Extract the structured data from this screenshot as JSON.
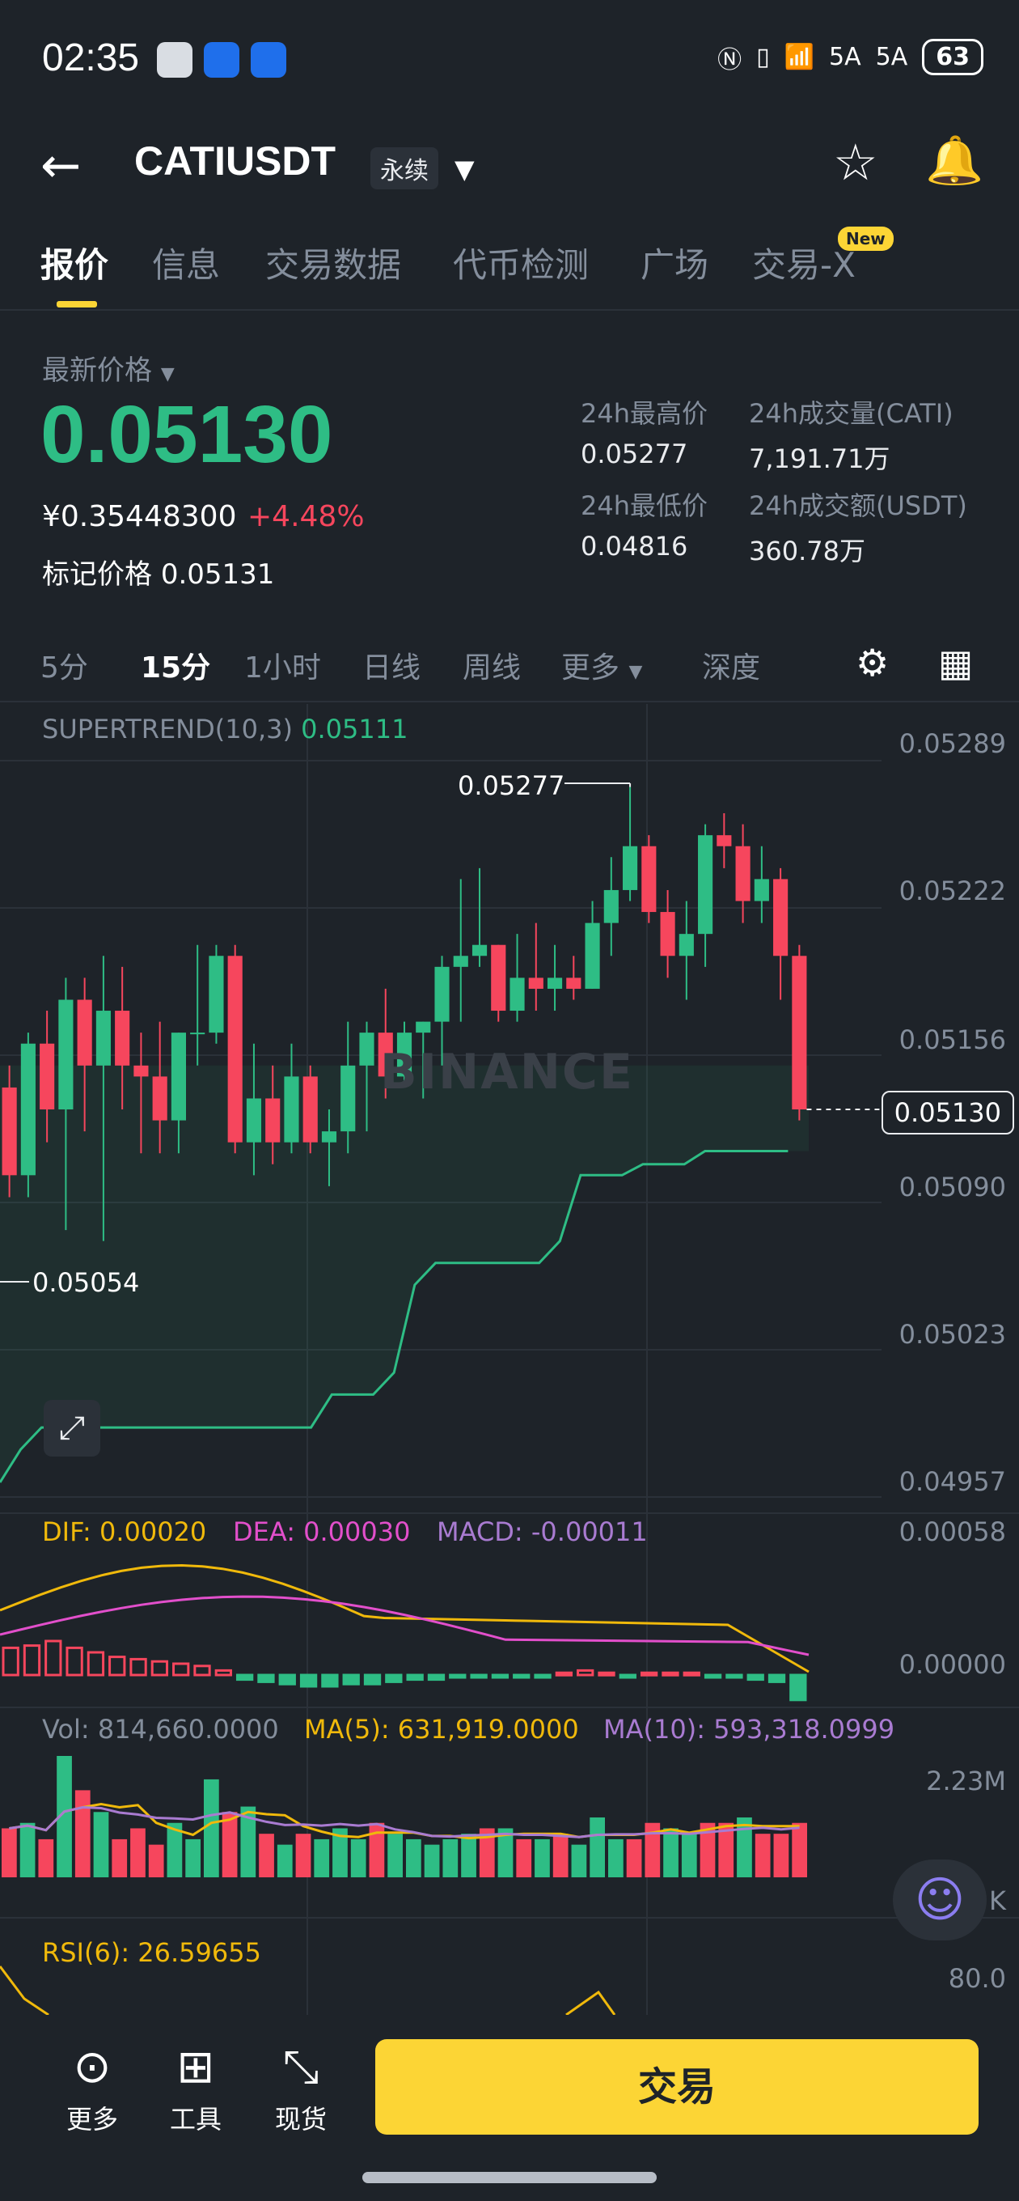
{
  "status_bar": {
    "time": "02:35",
    "network_icons": [
      "N",
      "vibrate",
      "wifi",
      "5A",
      "5A"
    ],
    "battery": "63"
  },
  "header": {
    "symbol": "CATIUSDT",
    "contract_type": "永续",
    "icons": [
      "back-arrow-icon",
      "caret-down-icon",
      "star-icon",
      "bell-icon"
    ]
  },
  "tabs": [
    {
      "label": "报价",
      "active": true
    },
    {
      "label": "信息"
    },
    {
      "label": "交易数据"
    },
    {
      "label": "代币检测"
    },
    {
      "label": "广场"
    },
    {
      "label": "交易-X",
      "badge": "New"
    }
  ],
  "price": {
    "label": "最新价格",
    "last": "0.05130",
    "cny": "¥0.35448300",
    "change": "+4.48%",
    "mark_label": "标记价格",
    "mark": "0.05131"
  },
  "stats": {
    "high_label": "24h最高价",
    "high": "0.05277",
    "vol_label": "24h成交量(CATI)",
    "vol": "7,191.71万",
    "low_label": "24h最低价",
    "low": "0.04816",
    "turnover_label": "24h成交额(USDT)",
    "turnover": "360.78万"
  },
  "intervals": [
    {
      "label": "5分"
    },
    {
      "label": "15分",
      "active": true
    },
    {
      "label": "1小时"
    },
    {
      "label": "日线"
    },
    {
      "label": "周线"
    },
    {
      "label": "更多"
    },
    {
      "label": "深度"
    }
  ],
  "chart": {
    "supertrend_label": "SUPERTREND(10,3)",
    "supertrend_value": "0.05111",
    "price_axis": [
      "0.05289",
      "0.05222",
      "0.05156",
      "0.05090",
      "0.05023",
      "0.04957"
    ],
    "current_price": "0.05130",
    "high_marker": "0.05277",
    "low_marker": "0.05054",
    "watermark": "BINANCE",
    "macd": {
      "dif": "DIF: 0.00020",
      "dea": "DEA: 0.00030",
      "macd": "MACD: -0.00011",
      "axis_top": "0.00058",
      "axis_zero": "0.00000"
    },
    "vol": {
      "vol": "Vol: 814,660.0000",
      "ma5": "MA(5): 631,919.0000",
      "ma10": "MA(10): 593,318.0999",
      "axis_top": "2.23M",
      "axis_k": "K"
    },
    "rsi": {
      "label": "RSI(6): 26.59655",
      "axis_top": "80.0"
    },
    "colors": {
      "up": "#2ebd85",
      "down": "#f6465d",
      "dif": "#f0b90b",
      "dea": "#e24fcb",
      "macd": "#a97bd1"
    }
  },
  "chart_data": {
    "type": "candlestick",
    "interval": "15分",
    "ylim": [
      0.04957,
      0.05289
    ],
    "candles": [
      {
        "o": 0.0514,
        "h": 0.0515,
        "l": 0.0509,
        "c": 0.051
      },
      {
        "o": 0.051,
        "h": 0.05165,
        "l": 0.0509,
        "c": 0.0516
      },
      {
        "o": 0.0516,
        "h": 0.05175,
        "l": 0.05115,
        "c": 0.0513
      },
      {
        "o": 0.0513,
        "h": 0.0519,
        "l": 0.05075,
        "c": 0.0518
      },
      {
        "o": 0.0518,
        "h": 0.0519,
        "l": 0.0512,
        "c": 0.0515
      },
      {
        "o": 0.0515,
        "h": 0.052,
        "l": 0.0507,
        "c": 0.05175
      },
      {
        "o": 0.05175,
        "h": 0.05195,
        "l": 0.0513,
        "c": 0.0515
      },
      {
        "o": 0.0515,
        "h": 0.05165,
        "l": 0.0511,
        "c": 0.05145
      },
      {
        "o": 0.05145,
        "h": 0.0517,
        "l": 0.0511,
        "c": 0.05125
      },
      {
        "o": 0.05125,
        "h": 0.05165,
        "l": 0.0511,
        "c": 0.05165
      },
      {
        "o": 0.05165,
        "h": 0.05205,
        "l": 0.0515,
        "c": 0.05165
      },
      {
        "o": 0.05165,
        "h": 0.05205,
        "l": 0.0516,
        "c": 0.052
      },
      {
        "o": 0.052,
        "h": 0.05205,
        "l": 0.0511,
        "c": 0.05115
      },
      {
        "o": 0.05115,
        "h": 0.0516,
        "l": 0.051,
        "c": 0.05135
      },
      {
        "o": 0.05135,
        "h": 0.0515,
        "l": 0.05105,
        "c": 0.05115
      },
      {
        "o": 0.05115,
        "h": 0.0516,
        "l": 0.0511,
        "c": 0.05145
      },
      {
        "o": 0.05145,
        "h": 0.0515,
        "l": 0.0511,
        "c": 0.05115
      },
      {
        "o": 0.05115,
        "h": 0.0513,
        "l": 0.05095,
        "c": 0.0512
      },
      {
        "o": 0.0512,
        "h": 0.0517,
        "l": 0.0511,
        "c": 0.0515
      },
      {
        "o": 0.0515,
        "h": 0.0517,
        "l": 0.0512,
        "c": 0.05165
      },
      {
        "o": 0.05165,
        "h": 0.05185,
        "l": 0.05135,
        "c": 0.05145
      },
      {
        "o": 0.05145,
        "h": 0.0517,
        "l": 0.0514,
        "c": 0.05165
      },
      {
        "o": 0.05165,
        "h": 0.0517,
        "l": 0.05135,
        "c": 0.0517
      },
      {
        "o": 0.0517,
        "h": 0.052,
        "l": 0.0515,
        "c": 0.05195
      },
      {
        "o": 0.05195,
        "h": 0.05235,
        "l": 0.0517,
        "c": 0.052
      },
      {
        "o": 0.052,
        "h": 0.0524,
        "l": 0.05195,
        "c": 0.05205
      },
      {
        "o": 0.05205,
        "h": 0.05205,
        "l": 0.0517,
        "c": 0.05175
      },
      {
        "o": 0.05175,
        "h": 0.0521,
        "l": 0.0517,
        "c": 0.0519
      },
      {
        "o": 0.0519,
        "h": 0.05215,
        "l": 0.05175,
        "c": 0.05185
      },
      {
        "o": 0.05185,
        "h": 0.05205,
        "l": 0.05175,
        "c": 0.0519
      },
      {
        "o": 0.0519,
        "h": 0.052,
        "l": 0.0518,
        "c": 0.05185
      },
      {
        "o": 0.05185,
        "h": 0.05225,
        "l": 0.05185,
        "c": 0.05215
      },
      {
        "o": 0.05215,
        "h": 0.05245,
        "l": 0.052,
        "c": 0.0523
      },
      {
        "o": 0.0523,
        "h": 0.05277,
        "l": 0.05225,
        "c": 0.0525
      },
      {
        "o": 0.0525,
        "h": 0.05255,
        "l": 0.05215,
        "c": 0.0522
      },
      {
        "o": 0.0522,
        "h": 0.0523,
        "l": 0.0519,
        "c": 0.052
      },
      {
        "o": 0.052,
        "h": 0.05225,
        "l": 0.0518,
        "c": 0.0521
      },
      {
        "o": 0.0521,
        "h": 0.0526,
        "l": 0.05195,
        "c": 0.05255
      },
      {
        "o": 0.05255,
        "h": 0.05265,
        "l": 0.0524,
        "c": 0.0525
      },
      {
        "o": 0.0525,
        "h": 0.0526,
        "l": 0.05215,
        "c": 0.05225
      },
      {
        "o": 0.05225,
        "h": 0.0525,
        "l": 0.05215,
        "c": 0.05235
      },
      {
        "o": 0.05235,
        "h": 0.0524,
        "l": 0.0518,
        "c": 0.052
      },
      {
        "o": 0.052,
        "h": 0.05205,
        "l": 0.05125,
        "c": 0.0513
      }
    ],
    "supertrend": [
      0.0496,
      0.04975,
      0.04985,
      0.04985,
      0.04985,
      0.04985,
      0.04985,
      0.04985,
      0.04985,
      0.04985,
      0.04985,
      0.04985,
      0.04985,
      0.04985,
      0.04985,
      0.04985,
      0.05,
      0.05,
      0.05,
      0.0501,
      0.0505,
      0.0506,
      0.0506,
      0.0506,
      0.0506,
      0.0506,
      0.0506,
      0.0507,
      0.051,
      0.051,
      0.051,
      0.05105,
      0.05105,
      0.05105,
      0.05111,
      0.05111,
      0.05111,
      0.05111,
      0.05111
    ],
    "macd_hist": [
      0.00012,
      0.00013,
      0.00015,
      0.00012,
      0.0001,
      8e-05,
      7e-05,
      6e-05,
      5e-05,
      4e-05,
      2e-05,
      -2e-05,
      -3e-05,
      -4e-05,
      -5e-05,
      -5e-05,
      -4e-05,
      -4e-05,
      -3e-05,
      -2e-05,
      -2e-05,
      -1e-05,
      -1e-05,
      -1e-05,
      -1e-05,
      -1e-05,
      1e-05,
      2e-05,
      1e-05,
      -1e-05,
      1e-05,
      1e-05,
      1e-05,
      -1e-05,
      -1e-05,
      -2e-05,
      -3e-05,
      -0.00011
    ],
    "volume": [
      0.9,
      1.0,
      0.7,
      2.23,
      1.6,
      1.2,
      0.7,
      0.9,
      0.6,
      1.0,
      0.7,
      1.8,
      1.2,
      1.3,
      0.8,
      0.6,
      0.8,
      0.7,
      0.9,
      0.7,
      1.0,
      0.8,
      0.7,
      0.6,
      0.7,
      0.8,
      0.9,
      0.9,
      0.7,
      0.7,
      0.8,
      0.6,
      1.1,
      0.7,
      0.7,
      1.0,
      0.9,
      0.8,
      1.0,
      1.0,
      1.1,
      0.8,
      0.8,
      1.0
    ]
  },
  "bottom_bar": {
    "more": "更多",
    "tools": "工具",
    "spot": "现货",
    "trade": "交易"
  }
}
